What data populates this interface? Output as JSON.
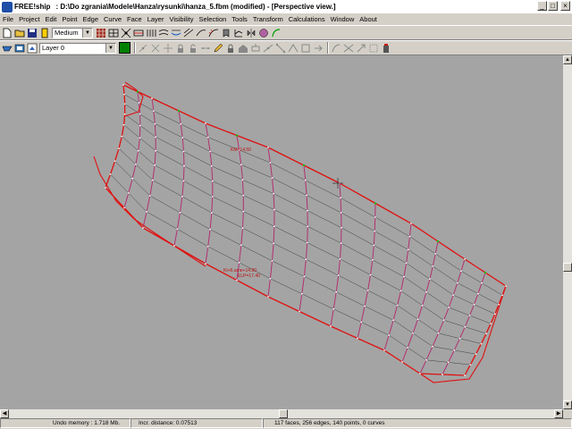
{
  "window": {
    "app_name": "FREE!ship",
    "title": ": D:\\Do zgrania\\Modele\\Hanza\\rysunki\\hanza_5.fbm (modified) - [Perspective view.]",
    "minimize": "_",
    "maximize": "□",
    "close": "×"
  },
  "menu": [
    "File",
    "Project",
    "Edit",
    "Point",
    "Edge",
    "Curve",
    "Face",
    "Layer",
    "Visibility",
    "Selection",
    "Tools",
    "Transform",
    "Calculations",
    "Window",
    "About"
  ],
  "toolbar1": {
    "precision_combo": "Medium"
  },
  "toolbar2": {
    "layer_combo": "Layer 0",
    "layer_color": "#008000"
  },
  "viewport": {
    "background": "#a4a4a4",
    "label_top": "KM+14,50",
    "label_mid": "Kt+6.ame+14.90",
    "label_mid2": "ELP=17.40"
  },
  "status": {
    "undo_memory": "Undo memory : 1.718 Mb.",
    "incr_distance": "Incr. distance: 0.07513",
    "counts": "117 faces, 256 edges, 140 points, 0 curves"
  },
  "colors": {
    "hull_edge": "#e01010",
    "grid_line": "#404040",
    "crease": "#b03070",
    "point": "#ffffff",
    "active_point": "#00cc00"
  }
}
